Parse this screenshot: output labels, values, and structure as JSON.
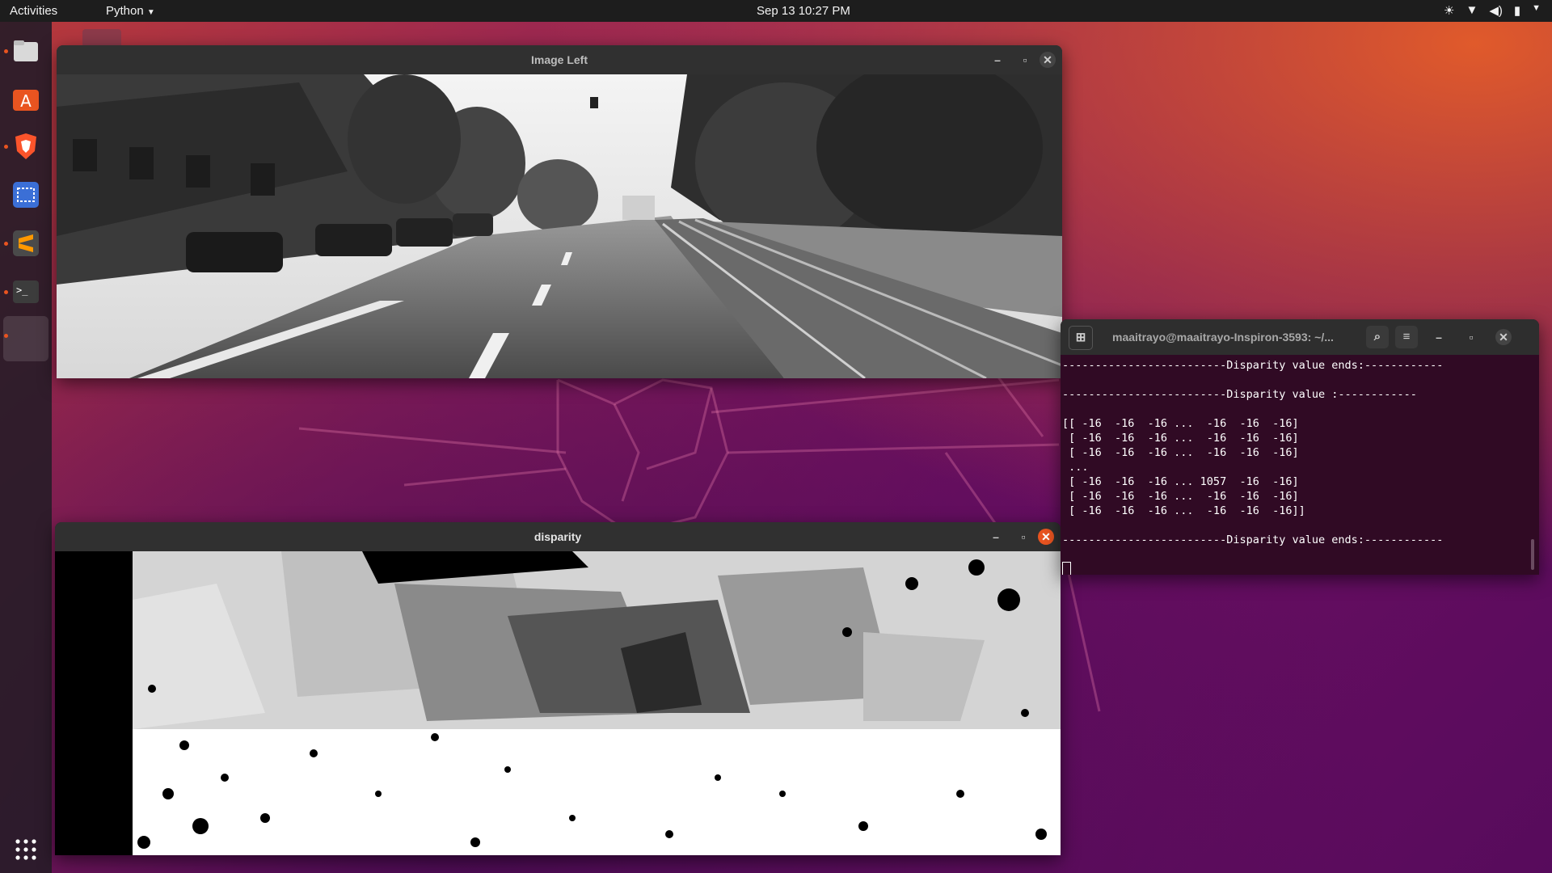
{
  "topbar": {
    "activities": "Activities",
    "app_menu": "Python",
    "clock": "Sep 13  10:27 PM"
  },
  "dock": {
    "items": [
      {
        "name": "files-icon"
      },
      {
        "name": "software-icon"
      },
      {
        "name": "brave-icon"
      },
      {
        "name": "screenshot-icon"
      },
      {
        "name": "sublime-icon"
      },
      {
        "name": "terminal-icon"
      },
      {
        "name": "python-window-icon"
      },
      {
        "name": "show-apps-icon"
      }
    ]
  },
  "window_left": {
    "title": "Image Left"
  },
  "window_disparity": {
    "title": "disparity"
  },
  "terminal": {
    "title": "maaitrayo@maaitrayo-Inspiron-3593: ~/...",
    "lines": [
      "-------------------------Disparity value ends:------------",
      "",
      "-------------------------Disparity value :------------",
      "",
      "[[ -16  -16  -16 ...  -16  -16  -16]",
      " [ -16  -16  -16 ...  -16  -16  -16]",
      " [ -16  -16  -16 ...  -16  -16  -16]",
      " ...",
      " [ -16  -16  -16 ... 1057  -16  -16]",
      " [ -16  -16  -16 ...  -16  -16  -16]",
      " [ -16  -16  -16 ...  -16  -16  -16]]",
      "",
      "-------------------------Disparity value ends:------------"
    ]
  },
  "colors": {
    "accent": "#e95420",
    "terminal_bg": "#300a24"
  }
}
